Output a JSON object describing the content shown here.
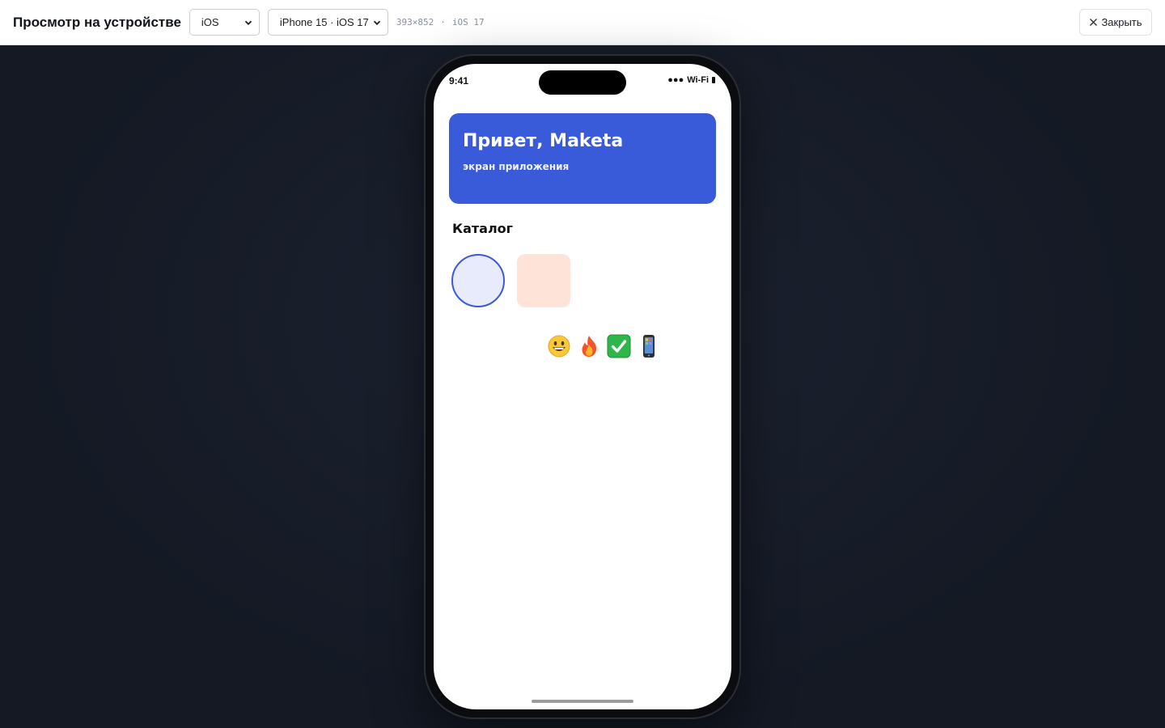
{
  "topbar": {
    "title": "Просмотр на устройстве",
    "os_select": {
      "value": "iOS"
    },
    "device_select": {
      "value": "iPhone 15 · iOS 17"
    },
    "meta": {
      "resolution": "393×852",
      "separator": "·",
      "os_version": "iOS 17"
    },
    "close_label": "Закрыть"
  },
  "phone": {
    "status": {
      "time": "9:41",
      "signal": "●●●",
      "wifi": "Wi-Fi"
    },
    "hero": {
      "title": "Привет, Maketa",
      "subtitle": "экран приложения"
    },
    "section_title": "Каталог",
    "emojis": [
      "smiling-face",
      "fire",
      "check-mark-button",
      "mobile-phone"
    ]
  },
  "colors": {
    "accent": "#3a5bd9",
    "circle_fill": "#e7ebfb",
    "square_fill": "#fde3d8",
    "stage_bg": "#141924"
  }
}
